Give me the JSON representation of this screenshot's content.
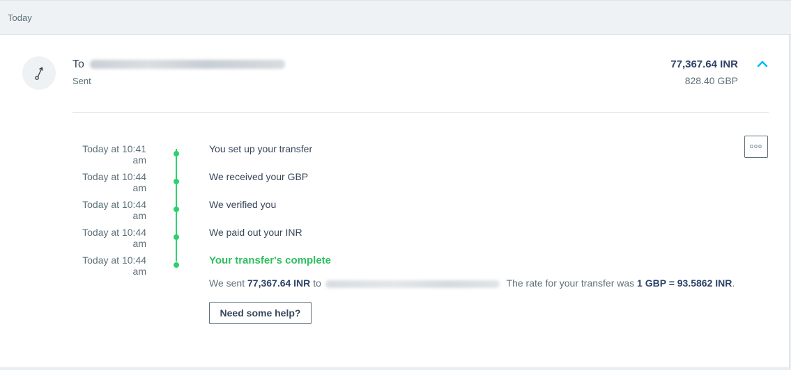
{
  "day_header": {
    "label": "Today"
  },
  "transfer": {
    "to_prefix": "To",
    "status": "Sent",
    "target_amount": "77,367.64 INR",
    "source_amount": "828.40 GBP",
    "icon": "arrow-up-right-icon",
    "collapse_icon": "chevron-up-icon",
    "more_icon": "more-dots-icon",
    "accent_color": "#2ed06e"
  },
  "timeline": [
    {
      "time": "Today at 10:41 am",
      "text": "You set up your transfer"
    },
    {
      "time": "Today at 10:44 am",
      "text": "We received your GBP"
    },
    {
      "time": "Today at 10:44 am",
      "text": "We verified you"
    },
    {
      "time": "Today at 10:44 am",
      "text": "We paid out your INR"
    },
    {
      "time": "Today at 10:44 am",
      "text": "Your transfer's complete"
    }
  ],
  "summary": {
    "part1": "We sent",
    "amount": "77,367.64 INR",
    "part2": "to",
    "part3": "The rate for your transfer was",
    "rate": "1 GBP = 93.5862 INR",
    "part4": "."
  },
  "help_button": {
    "label": "Need some help?"
  },
  "more_button": {
    "label": "ooo"
  }
}
